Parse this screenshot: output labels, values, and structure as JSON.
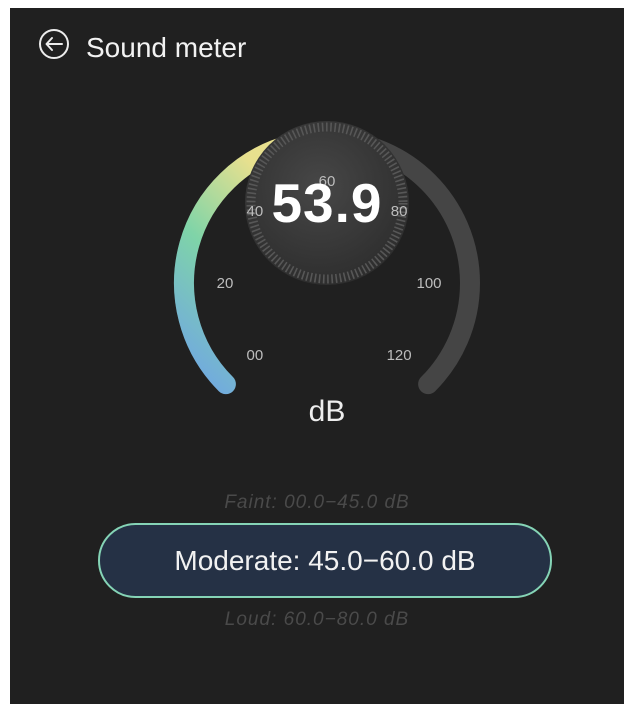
{
  "header": {
    "title": "Sound meter",
    "back_icon": "back-arrow-icon"
  },
  "meter": {
    "reading": "53.9",
    "unit": "dB",
    "level_fraction": 0.449,
    "scale_labels": [
      "00",
      "20",
      "40",
      "60",
      "80",
      "100",
      "120"
    ],
    "colors": {
      "track": "#454545",
      "fill_start": "#6fa3e8",
      "fill_mid": "#7fd4a8",
      "fill_end": "#e8e08e",
      "dial": "#3a3a3a"
    }
  },
  "ranges": {
    "faint": "Faint: 00.0−45.0 dB",
    "current": "Moderate: 45.0−60.0 dB",
    "loud": "Loud: 60.0−80.0 dB"
  },
  "colors": {
    "background": "#202020",
    "accent_border": "#85d4b6",
    "pill_background": "#253145"
  }
}
